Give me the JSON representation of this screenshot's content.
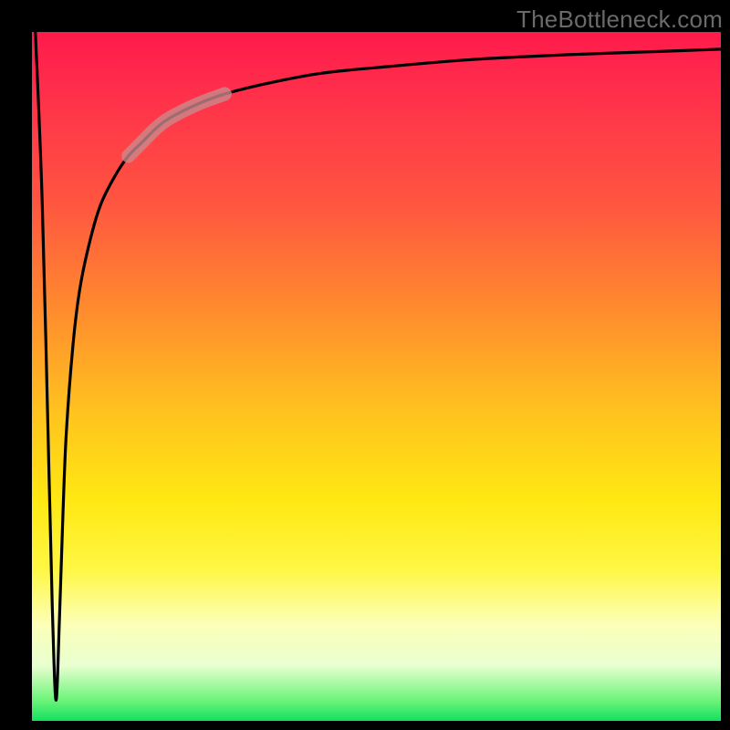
{
  "watermark": "TheBottleneck.com",
  "colors": {
    "frame_bg": "#000000",
    "gradient_top": "#ff1a4b",
    "gradient_mid1": "#ff8a2e",
    "gradient_mid2": "#ffe812",
    "gradient_bottom": "#12e05e",
    "curve_stroke": "#000000",
    "highlight_stroke": "#c98a8d"
  },
  "chart_data": {
    "type": "line",
    "title": "",
    "xlabel": "",
    "ylabel": "",
    "xlim": [
      0,
      100
    ],
    "ylim": [
      0,
      100
    ],
    "note": "Axes unlabeled; values read as percent of plot width/height. Curve drops sharply from top-left to a narrow trough near x≈3.5, y≈3, then rises steeply and asymptotically approaches y≈97 toward the right. A muted red highlight marks the segment around x≈16–22.",
    "series": [
      {
        "name": "curve",
        "x": [
          0.5,
          1.5,
          2.5,
          3.0,
          3.5,
          4.0,
          4.5,
          5.0,
          6.0,
          7.0,
          8.5,
          10,
          12,
          14,
          16,
          18,
          20,
          24,
          28,
          34,
          42,
          52,
          64,
          78,
          92,
          100
        ],
        "y": [
          100,
          75,
          35,
          15,
          3,
          15,
          30,
          42,
          55,
          63,
          70,
          75,
          79,
          82,
          84,
          86,
          87.5,
          89.5,
          91,
          92.5,
          94,
          95,
          96,
          96.7,
          97.2,
          97.5
        ]
      }
    ],
    "highlight_segment": {
      "x_start": 16,
      "x_end": 22,
      "series": "curve"
    }
  }
}
